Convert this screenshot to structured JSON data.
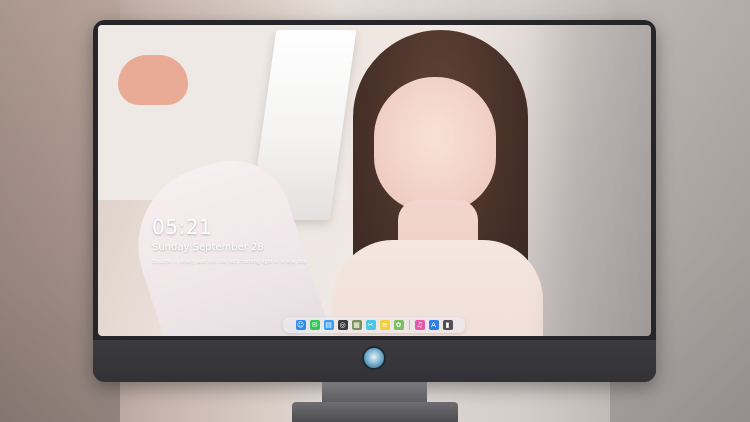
{
  "lock_screen": {
    "time": "05:21",
    "date": "Sunday September 28",
    "quote": "Breathe in slowly and feel the soft morning light of a new day"
  },
  "dock": {
    "apps": [
      {
        "icon": "finder-icon",
        "glyph": "☺",
        "color": "#2e8cf0"
      },
      {
        "icon": "messages-icon",
        "glyph": "✉",
        "color": "#35c759"
      },
      {
        "icon": "folder-icon",
        "glyph": "▤",
        "color": "#3aa0f3"
      },
      {
        "icon": "safari-icon",
        "glyph": "◎",
        "color": "#3b3b3f"
      },
      {
        "icon": "preview-icon",
        "glyph": "▦",
        "color": "#7a8f5a"
      },
      {
        "icon": "clapper-icon",
        "glyph": "✂",
        "color": "#4dc6e6"
      },
      {
        "icon": "notes-icon",
        "glyph": "≡",
        "color": "#f3cf3b"
      },
      {
        "icon": "photos-icon",
        "glyph": "✿",
        "color": "#7bbf5f"
      },
      {
        "icon": "itunes-icon",
        "glyph": "♫",
        "color": "#e657a9"
      },
      {
        "icon": "app-store-icon",
        "glyph": "A",
        "color": "#2f7fe6"
      },
      {
        "icon": "trash-icon",
        "glyph": "▮",
        "color": "#505057"
      }
    ]
  },
  "colors": {
    "monitor_bezel": "#26262a",
    "chin": "#3b3b40",
    "dock_bg": "#ebebee"
  }
}
